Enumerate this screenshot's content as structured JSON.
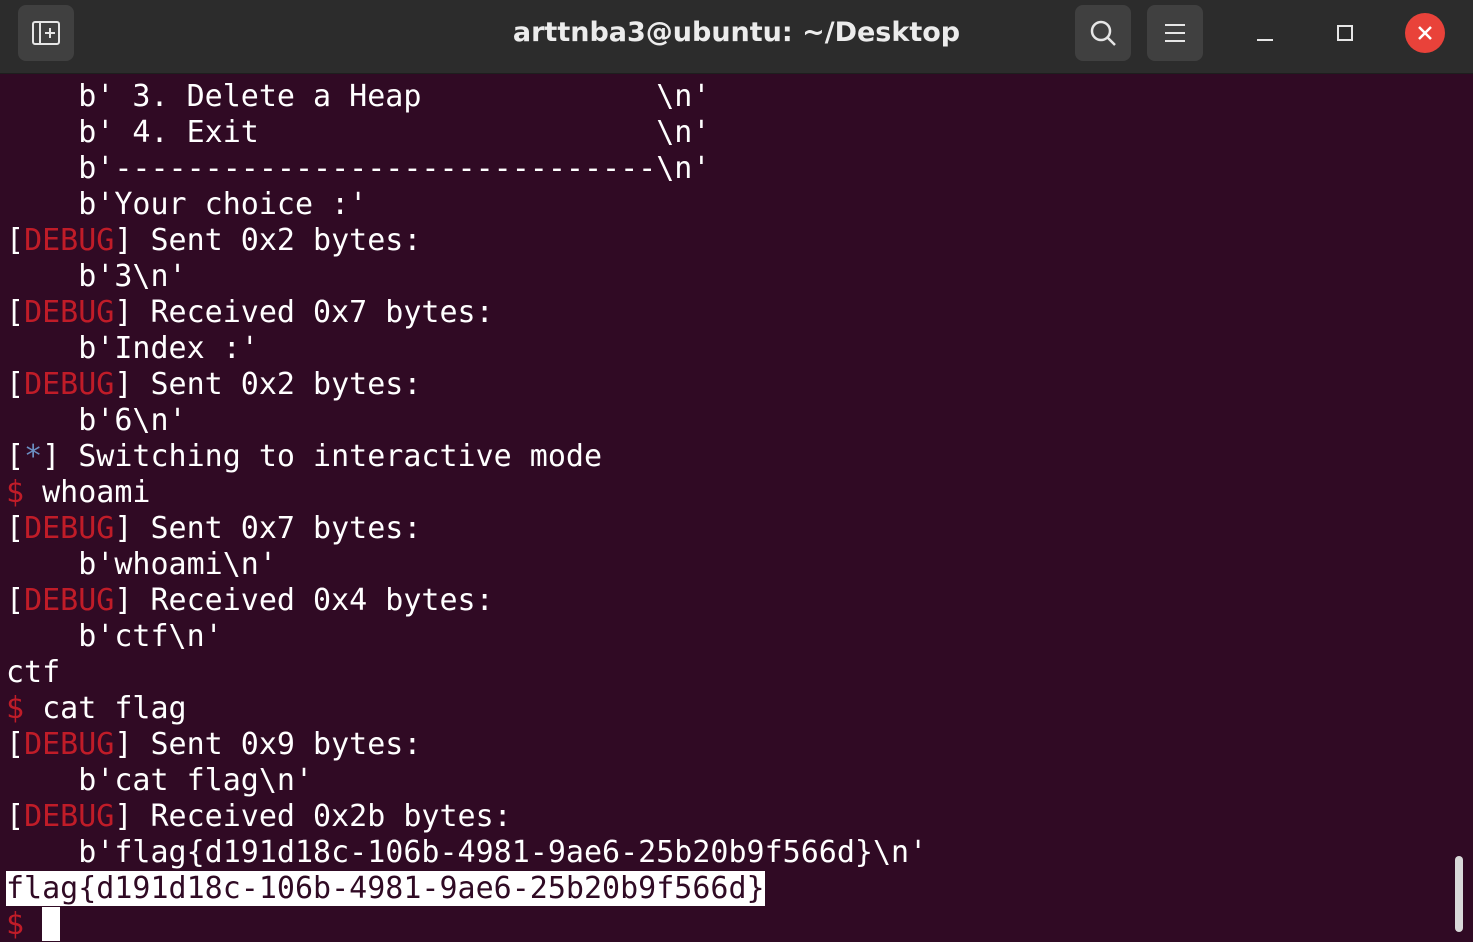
{
  "window": {
    "title": "arttnba3@ubuntu: ~/Desktop",
    "icons": {
      "new_tab": "new-tab-icon",
      "search": "search-icon",
      "menu": "hamburger-menu-icon",
      "minimize": "minimize-icon",
      "maximize": "maximize-icon",
      "close": "close-icon"
    },
    "colors": {
      "background": "#300a24",
      "titlebar": "#2c2c2c",
      "debug": "#c01c28",
      "prompt": "#c01c28",
      "close": "#e9423a"
    }
  },
  "terminal": {
    "lines": [
      {
        "indent": "    ",
        "text": "b' 3. Delete a Heap             \\n'"
      },
      {
        "indent": "    ",
        "text": "b' 4. Exit                      \\n'"
      },
      {
        "indent": "    ",
        "text": "b'------------------------------\\n'"
      },
      {
        "indent": "    ",
        "text": "b'Your choice :'"
      },
      {
        "tag": "DEBUG",
        "text": " Sent 0x2 bytes:"
      },
      {
        "indent": "    ",
        "text": "b'3\\n'"
      },
      {
        "tag": "DEBUG",
        "text": " Received 0x7 bytes:"
      },
      {
        "indent": "    ",
        "text": "b'Index :'"
      },
      {
        "tag": "DEBUG",
        "text": " Sent 0x2 bytes:"
      },
      {
        "indent": "    ",
        "text": "b'6\\n'"
      },
      {
        "tag": "*",
        "text": " Switching to interactive mode"
      },
      {
        "prompt": "$",
        "text": " whoami"
      },
      {
        "tag": "DEBUG",
        "text": " Sent 0x7 bytes:"
      },
      {
        "indent": "    ",
        "text": "b'whoami\\n'"
      },
      {
        "tag": "DEBUG",
        "text": " Received 0x4 bytes:"
      },
      {
        "indent": "    ",
        "text": "b'ctf\\n'"
      },
      {
        "text": "ctf"
      },
      {
        "prompt": "$",
        "text": " cat flag"
      },
      {
        "tag": "DEBUG",
        "text": " Sent 0x9 bytes:"
      },
      {
        "indent": "    ",
        "text": "b'cat flag\\n'"
      },
      {
        "tag": "DEBUG",
        "text": " Received 0x2b bytes:"
      },
      {
        "indent": "    ",
        "text": "b'flag{d191d18c-106b-4981-9ae6-25b20b9f566d}\\n'"
      },
      {
        "highlight": true,
        "text": "flag{d191d18c-106b-4981-9ae6-25b20b9f566d}"
      },
      {
        "prompt": "$",
        "text": " ",
        "cursor": true
      }
    ]
  }
}
